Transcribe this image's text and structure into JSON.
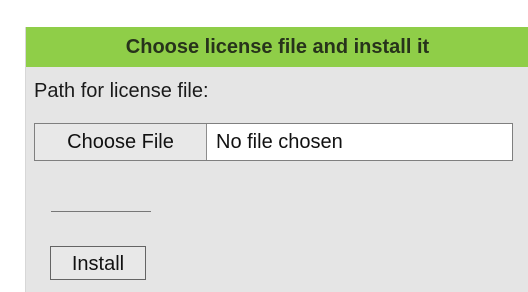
{
  "license_panel": {
    "title": "Choose license file and install it",
    "path_label": "Path for license file:",
    "file_input": {
      "button_label": "Choose File",
      "status_text": "No file chosen"
    },
    "install_button_label": "Install"
  }
}
